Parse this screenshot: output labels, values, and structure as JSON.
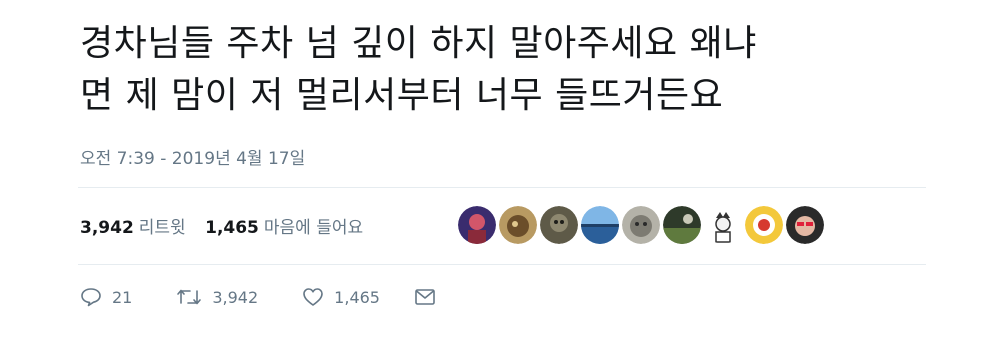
{
  "tweet": {
    "text_lines": [
      "경차님들 주차 넘 깊이 하지 말아주세요 왜냐",
      "면 제 맘이 저 멀리서부터 너무 들뜨거든요"
    ],
    "timestamp": "오전 7:39 - 2019년 4월 17일"
  },
  "stats": {
    "retweets_count": "3,942",
    "retweets_label": "리트윗",
    "likes_count": "1,465",
    "likes_label": "마음에 들어요"
  },
  "avatars": [
    {
      "name": "avatar-1",
      "color": "#3a2c6e"
    },
    {
      "name": "avatar-2",
      "color": "#9a7a4a"
    },
    {
      "name": "avatar-3",
      "color": "#5e5a48"
    },
    {
      "name": "avatar-4",
      "color": "#3d7fc1"
    },
    {
      "name": "avatar-5",
      "color": "#8e8d86"
    },
    {
      "name": "avatar-6",
      "color": "#4d5a3e"
    },
    {
      "name": "avatar-7",
      "color": "#e8e8e8"
    },
    {
      "name": "avatar-8",
      "color": "#f3c83b"
    },
    {
      "name": "avatar-9",
      "color": "#2a2a2a"
    }
  ],
  "actions": {
    "reply_count": "21",
    "retweet_count": "3,942",
    "like_count": "1,465",
    "icons": [
      "reply-icon",
      "retweet-icon",
      "like-icon",
      "message-icon"
    ]
  },
  "colors": {
    "text": "#14171a",
    "muted": "#657786",
    "divider": "#e6ecf0"
  }
}
